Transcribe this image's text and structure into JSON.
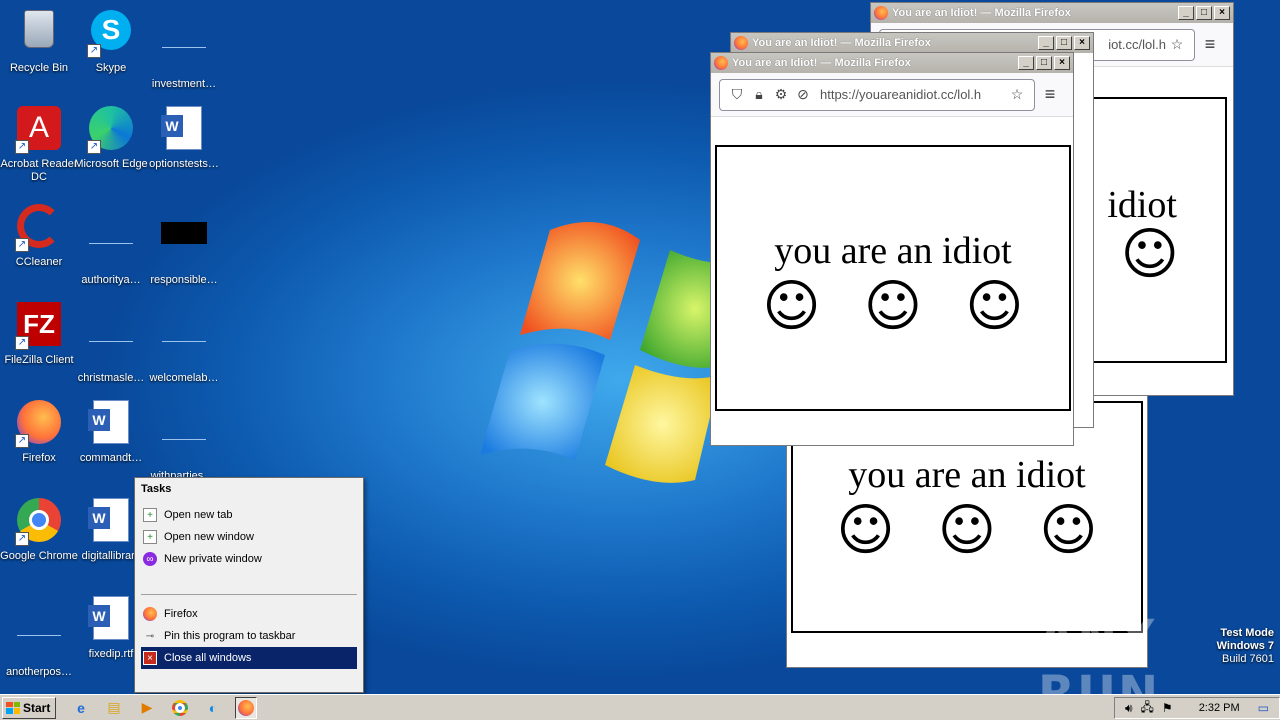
{
  "desktop": {
    "icons": [
      {
        "label": "Recycle Bin",
        "icon": "recycle-bin-icon"
      },
      {
        "label": "Skype",
        "icon": "skype-icon"
      },
      {
        "label": "investment…",
        "icon": "file-icon"
      },
      {
        "label": "Acrobat Reader DC",
        "icon": "acrobat-icon"
      },
      {
        "label": "Microsoft Edge",
        "icon": "edge-icon"
      },
      {
        "label": "optionstests…",
        "icon": "word-doc-icon"
      },
      {
        "label": "CCleaner",
        "icon": "ccleaner-icon"
      },
      {
        "label": "authoritya…",
        "icon": "file-icon"
      },
      {
        "label": "responsible…",
        "icon": "file-icon"
      },
      {
        "label": "FileZilla Client",
        "icon": "filezilla-icon"
      },
      {
        "label": "christmasle…",
        "icon": "file-icon"
      },
      {
        "label": "welcomelab…",
        "icon": "file-icon"
      },
      {
        "label": "Firefox",
        "icon": "firefox-icon"
      },
      {
        "label": "commandt…",
        "icon": "word-doc-icon"
      },
      {
        "label": "withparties.…",
        "icon": "file-icon"
      },
      {
        "label": "Google Chrome",
        "icon": "chrome-icon"
      },
      {
        "label": "digitallibrary",
        "icon": "word-doc-icon"
      },
      {
        "label": "anotherpos…",
        "icon": "file-icon"
      },
      {
        "label": "fixedip.rtf",
        "icon": "word-doc-icon"
      }
    ]
  },
  "windows": {
    "title": "You are an Idiot! — Mozilla Firefox",
    "url_front": "https://youareanidiot.cc/lol.h",
    "url_back": "iot.cc/lol.h",
    "page_text": "you are an idiot",
    "page_text_partial": "idiot",
    "smiley": "☺"
  },
  "jumplist": {
    "heading": "Tasks",
    "tasks": [
      "Open new tab",
      "Open new window",
      "New private window"
    ],
    "app": "Firefox",
    "pin": "Pin this program to taskbar",
    "close": "Close all windows"
  },
  "taskbar": {
    "start": "Start",
    "clock": "2:32 PM"
  },
  "watermark": {
    "line1": "Test Mode",
    "line2": "Windows 7",
    "line3": "Build 7601",
    "brand": "ANY RUN"
  }
}
